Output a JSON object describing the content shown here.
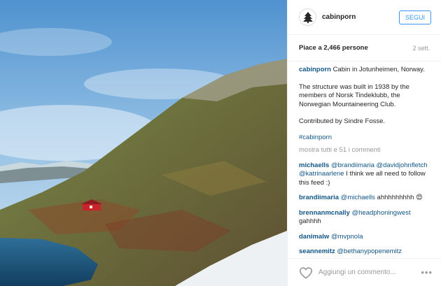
{
  "header": {
    "username": "cabinporn",
    "follow_label": "SEGUI"
  },
  "meta": {
    "likes": "Piace a 2,466 persone",
    "time_ago": "2 sett."
  },
  "caption": {
    "username": "cabinporn",
    "line1": "Cabin in Jotunheimen, Norway.",
    "line2": "The structure was built in 1938 by the members of Norsk Tindeklubb, the Norwegian Mountaineering Club.",
    "line3": "Contributed by Sindre Fosse.",
    "hashtag": "#cabinporn"
  },
  "view_all": "mostra tutti e 51 i commenti",
  "comments": [
    {
      "user": "michaells",
      "m1": "@brandiimaria",
      "m2": "@davidjohnfletch",
      "m3": "@katrinaarlene",
      "text": " I think we all need to follow this feed :)"
    },
    {
      "user": "brandiimaria",
      "m1": "@michaells",
      "text": " ahhhhhhhhh 😍"
    },
    {
      "user": "brennanmcnally",
      "m1": "@headphoningwest",
      "text": " gahhhh"
    },
    {
      "user": "danimalw",
      "m1": "@mvpnola"
    },
    {
      "user": "seannemitz",
      "m1": "@bethanypopenemitz"
    }
  ],
  "footer": {
    "placeholder": "Aggiungi un commento...",
    "more": "•••"
  },
  "icons": {
    "avatar": "tree-logo-icon",
    "like": "heart-icon",
    "options": "more-dots-icon"
  }
}
